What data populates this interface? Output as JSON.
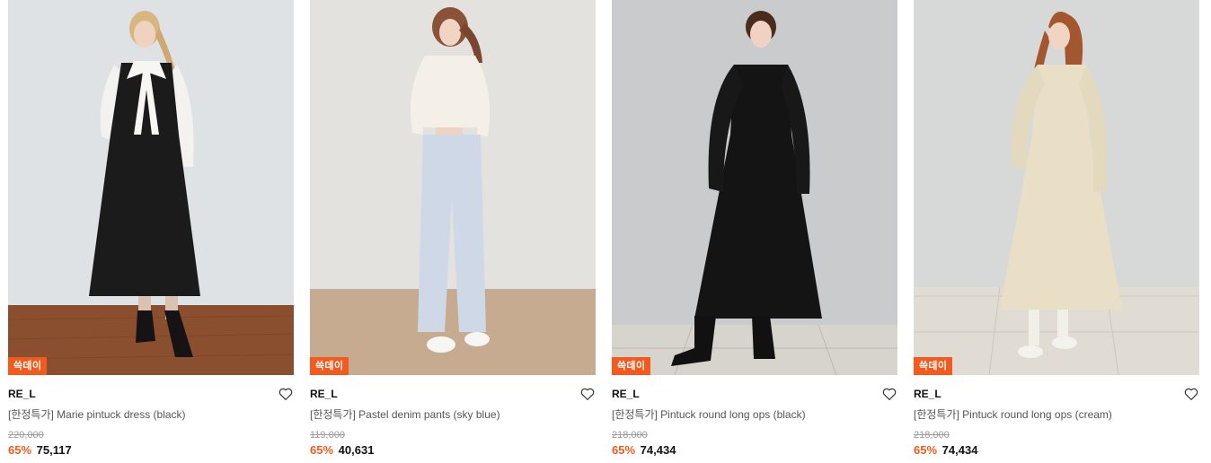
{
  "colors": {
    "accent": "#f25a1f",
    "text_primary": "#111111",
    "text_secondary": "#555555",
    "text_muted": "#9a9a9a"
  },
  "products": [
    {
      "badge": "쓱데이",
      "brand": "RE_L",
      "name": "[한정특가] Marie pintuck dress (black)",
      "original_price": "220,000",
      "discount": "65%",
      "price": "75,117",
      "wish_icon": "heart-outline-icon"
    },
    {
      "badge": "쓱데이",
      "brand": "RE_L",
      "name": "[한정특가] Pastel denim pants (sky blue)",
      "original_price": "119,000",
      "discount": "65%",
      "price": "40,631",
      "wish_icon": "heart-outline-icon"
    },
    {
      "badge": "쓱데이",
      "brand": "RE_L",
      "name": "[한정특가] Pintuck round long ops (black)",
      "original_price": "218,000",
      "discount": "65%",
      "price": "74,434",
      "wish_icon": "heart-outline-icon"
    },
    {
      "badge": "쓱데이",
      "brand": "RE_L",
      "name": "[한정특가] Pintuck round long ops (cream)",
      "original_price": "218,000",
      "discount": "65%",
      "price": "74,434",
      "wish_icon": "heart-outline-icon"
    }
  ]
}
